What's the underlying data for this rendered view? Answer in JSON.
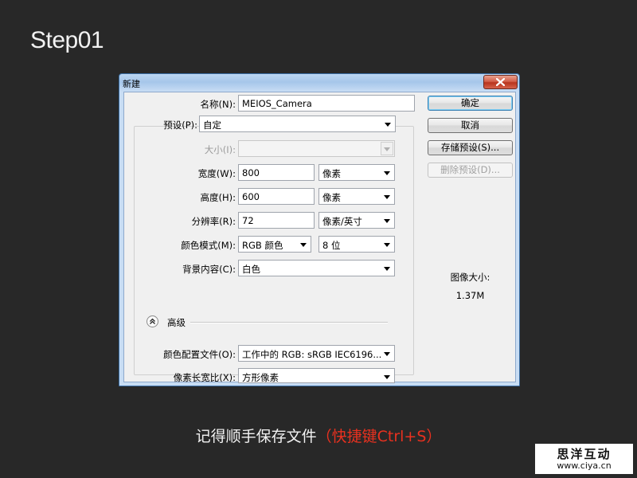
{
  "page": {
    "step_title": "Step01"
  },
  "dialog": {
    "title": "新建",
    "fields": {
      "name_label": "名称(N):",
      "name_value": "MEIOS_Camera",
      "preset_label": "预设(P):",
      "preset_value": "自定",
      "size_label": "大小(I):",
      "size_value": "",
      "width_label": "宽度(W):",
      "width_value": "800",
      "width_unit": "像素",
      "height_label": "高度(H):",
      "height_value": "600",
      "height_unit": "像素",
      "resolution_label": "分辨率(R):",
      "resolution_value": "72",
      "resolution_unit": "像素/英寸",
      "color_mode_label": "颜色模式(M):",
      "color_mode_value": "RGB 颜色",
      "bit_depth_value": "8 位",
      "background_label": "背景内容(C):",
      "background_value": "白色",
      "advanced_label": "高级",
      "color_profile_label": "颜色配置文件(O):",
      "color_profile_value": "工作中的 RGB: sRGB IEC6196...",
      "pixel_aspect_label": "像素长宽比(X):",
      "pixel_aspect_value": "方形像素"
    },
    "buttons": {
      "ok": "确定",
      "cancel": "取消",
      "save_preset": "存储预设(S)...",
      "delete_preset": "删除预设(D)..."
    },
    "image_size": {
      "label": "图像大小:",
      "value": "1.37M"
    }
  },
  "caption": {
    "text": "记得顺手保存文件",
    "shortcut": "（快捷键Ctrl+S）"
  },
  "logo": {
    "text": "思洋互动",
    "url": "www.ciya.cn"
  },
  "colors": {
    "background": "#282828",
    "highlight": "#e8311f",
    "title_bar": "#a6c6ea"
  }
}
